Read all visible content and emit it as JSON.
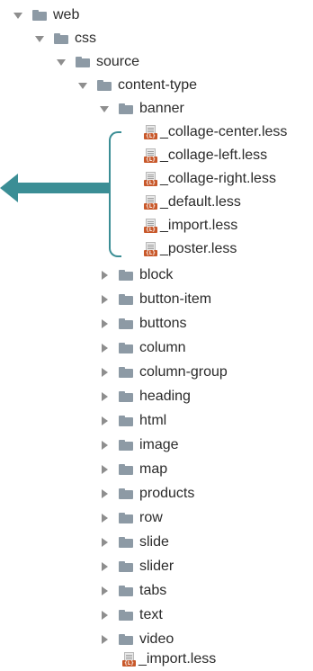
{
  "tree": [
    {
      "label": "web",
      "type": "folder",
      "expanded": true
    },
    {
      "label": "css",
      "type": "folder",
      "expanded": true
    },
    {
      "label": "source",
      "type": "folder",
      "expanded": true
    },
    {
      "label": "content-type",
      "type": "folder",
      "expanded": true
    },
    {
      "label": "banner",
      "type": "folder",
      "expanded": true
    },
    {
      "label": "_collage-center.less",
      "type": "less-file"
    },
    {
      "label": "_collage-left.less",
      "type": "less-file"
    },
    {
      "label": "_collage-right.less",
      "type": "less-file"
    },
    {
      "label": "_default.less",
      "type": "less-file"
    },
    {
      "label": "_import.less",
      "type": "less-file"
    },
    {
      "label": "_poster.less",
      "type": "less-file"
    },
    {
      "label": "block",
      "type": "folder",
      "expanded": false
    },
    {
      "label": "button-item",
      "type": "folder",
      "expanded": false
    },
    {
      "label": "buttons",
      "type": "folder",
      "expanded": false
    },
    {
      "label": "column",
      "type": "folder",
      "expanded": false
    },
    {
      "label": "column-group",
      "type": "folder",
      "expanded": false
    },
    {
      "label": "heading",
      "type": "folder",
      "expanded": false
    },
    {
      "label": "html",
      "type": "folder",
      "expanded": false
    },
    {
      "label": "image",
      "type": "folder",
      "expanded": false
    },
    {
      "label": "map",
      "type": "folder",
      "expanded": false
    },
    {
      "label": "products",
      "type": "folder",
      "expanded": false
    },
    {
      "label": "row",
      "type": "folder",
      "expanded": false
    },
    {
      "label": "slide",
      "type": "folder",
      "expanded": false
    },
    {
      "label": "slider",
      "type": "folder",
      "expanded": false
    },
    {
      "label": "tabs",
      "type": "folder",
      "expanded": false
    },
    {
      "label": "text",
      "type": "folder",
      "expanded": false
    },
    {
      "label": "video",
      "type": "folder",
      "expanded": false
    },
    {
      "label": "_import.less",
      "type": "less-file"
    }
  ],
  "file_badge": "{L}",
  "colors": {
    "highlight": "#3b8e95",
    "folder": "#8d9aa5",
    "less_badge": "#c8582a"
  }
}
